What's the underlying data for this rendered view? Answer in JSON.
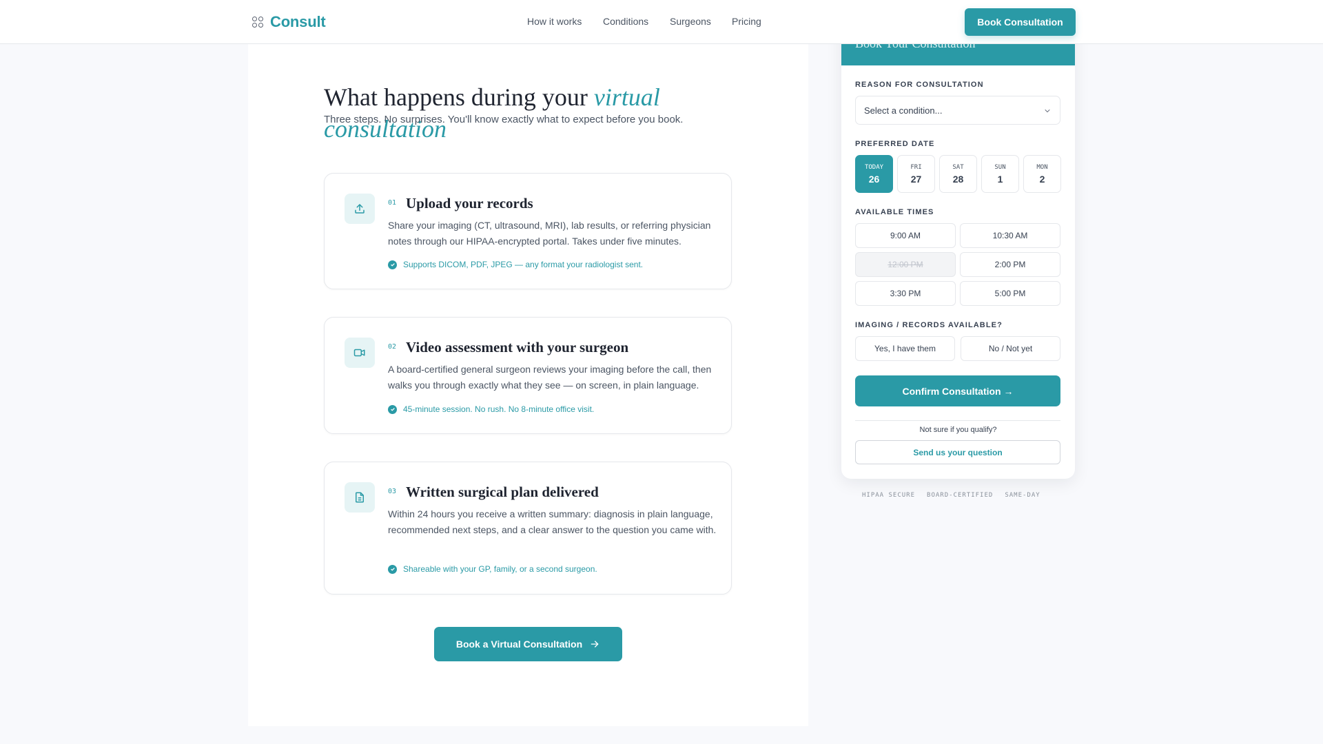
{
  "nav": {
    "brand": "Consult",
    "links": [
      "How it works",
      "Conditions",
      "Surgeons",
      "Pricing"
    ],
    "cta": "Book Consultation"
  },
  "hero": {
    "title_plain": "What happens during your",
    "title_accent": "virtual consultation",
    "subtitle": "Three steps. No surprises. You'll know exactly what to expect before you book."
  },
  "steps": [
    {
      "num": "01",
      "icon": "upload-icon",
      "title": "Upload your records",
      "body": "Share your imaging (CT, ultrasound, MRI), lab results, or referring physician notes through our HIPAA-encrypted portal. Takes under five minutes.",
      "note": "Supports DICOM, PDF, JPEG — any format your radiologist sent."
    },
    {
      "num": "02",
      "icon": "video-icon",
      "title": "Video assessment with your surgeon",
      "body": "A board-certified general surgeon reviews your imaging before the call, then walks you through exactly what they see — on screen, in plain language.",
      "note": "45-minute session. No rush. No 8-minute office visit."
    },
    {
      "num": "03",
      "icon": "document-icon",
      "title": "Written surgical plan delivered",
      "body": "Within 24 hours you receive a written summary: diagnosis in plain language, recommended next steps, and a clear answer to the question you came with.",
      "note": "Shareable with your GP, family, or a second surgeon."
    }
  ],
  "main_cta": "Book a Virtual Consultation",
  "booking": {
    "header": "Book Your Consultation",
    "reason_label": "REASON FOR CONSULTATION",
    "reason_placeholder": "Select a condition...",
    "date_label": "PREFERRED DATE",
    "dates": [
      {
        "day": "TODAY",
        "date": "26",
        "selected": true
      },
      {
        "day": "FRI",
        "date": "27",
        "selected": false
      },
      {
        "day": "SAT",
        "date": "28",
        "selected": false
      },
      {
        "day": "SUN",
        "date": "1",
        "selected": false
      },
      {
        "day": "MON",
        "date": "2",
        "selected": false
      }
    ],
    "times_label": "AVAILABLE TIMES",
    "times": [
      {
        "label": "9:00 AM",
        "available": true
      },
      {
        "label": "10:30 AM",
        "available": true
      },
      {
        "label": "12:00 PM",
        "available": false
      },
      {
        "label": "2:00 PM",
        "available": true
      },
      {
        "label": "3:30 PM",
        "available": true
      },
      {
        "label": "5:00 PM",
        "available": true
      }
    ],
    "imaging_label": "IMAGING / RECORDS AVAILABLE?",
    "imaging_yes": "Yes, I have them",
    "imaging_no": "No / Not yet",
    "confirm": "Confirm Consultation →",
    "qualify_text": "Not sure if you qualify?",
    "question_button": "Send us your question"
  },
  "badges": [
    "HIPAA SECURE",
    "BOARD-CERTIFIED",
    "SAME-DAY"
  ],
  "colors": {
    "accent": "#2a9aa6",
    "background": "#f8f9fc",
    "text": "#1f2937"
  }
}
